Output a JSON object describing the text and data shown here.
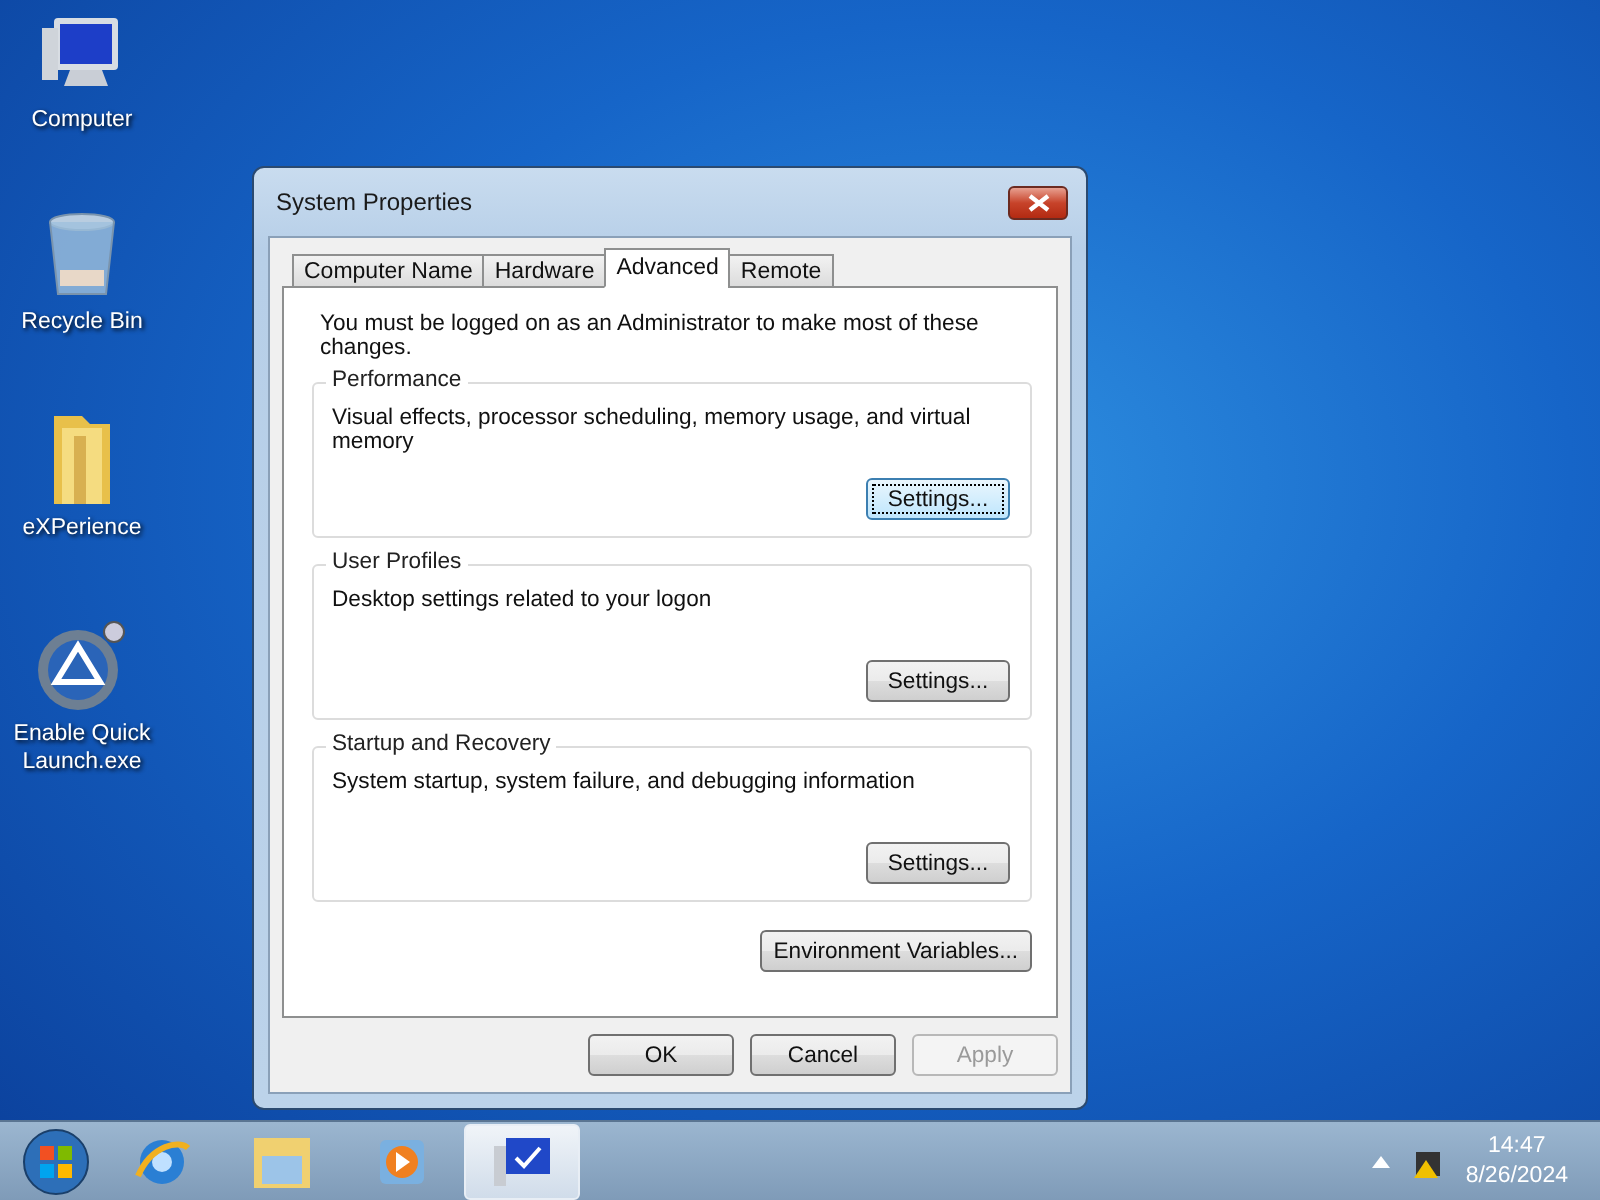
{
  "desktop_icons": [
    {
      "kind": "computer",
      "label": "Computer"
    },
    {
      "kind": "recycle",
      "label": "Recycle Bin"
    },
    {
      "kind": "folder",
      "label": "eXPerience"
    },
    {
      "kind": "launcher",
      "label": "Enable Quick Launch.exe"
    }
  ],
  "window": {
    "title": "System Properties",
    "tabs": [
      {
        "label": "Computer Name",
        "selected": false
      },
      {
        "label": "Hardware",
        "selected": false
      },
      {
        "label": "Advanced",
        "selected": true
      },
      {
        "label": "Remote",
        "selected": false
      }
    ],
    "notice": "You must be logged on as an Administrator to make most of these changes.",
    "groups": [
      {
        "title": "Performance",
        "description": "Visual effects, processor scheduling, memory usage, and virtual memory",
        "button": "Settings...",
        "focused": true
      },
      {
        "title": "User Profiles",
        "description": "Desktop settings related to your logon",
        "button": "Settings...",
        "focused": false
      },
      {
        "title": "Startup and Recovery",
        "description": "System startup, system failure, and debugging information",
        "button": "Settings...",
        "focused": false
      }
    ],
    "environment_button": "Environment Variables...",
    "buttons": [
      {
        "label": "OK",
        "disabled": false
      },
      {
        "label": "Cancel",
        "disabled": false
      },
      {
        "label": "Apply",
        "disabled": true
      }
    ]
  },
  "taskbar": {
    "items": [
      {
        "kind": "browser",
        "selected": false
      },
      {
        "kind": "explorer",
        "selected": false
      },
      {
        "kind": "media",
        "selected": false
      },
      {
        "kind": "system",
        "selected": true
      }
    ],
    "time": "14:47",
    "date": "8/26/2024"
  }
}
